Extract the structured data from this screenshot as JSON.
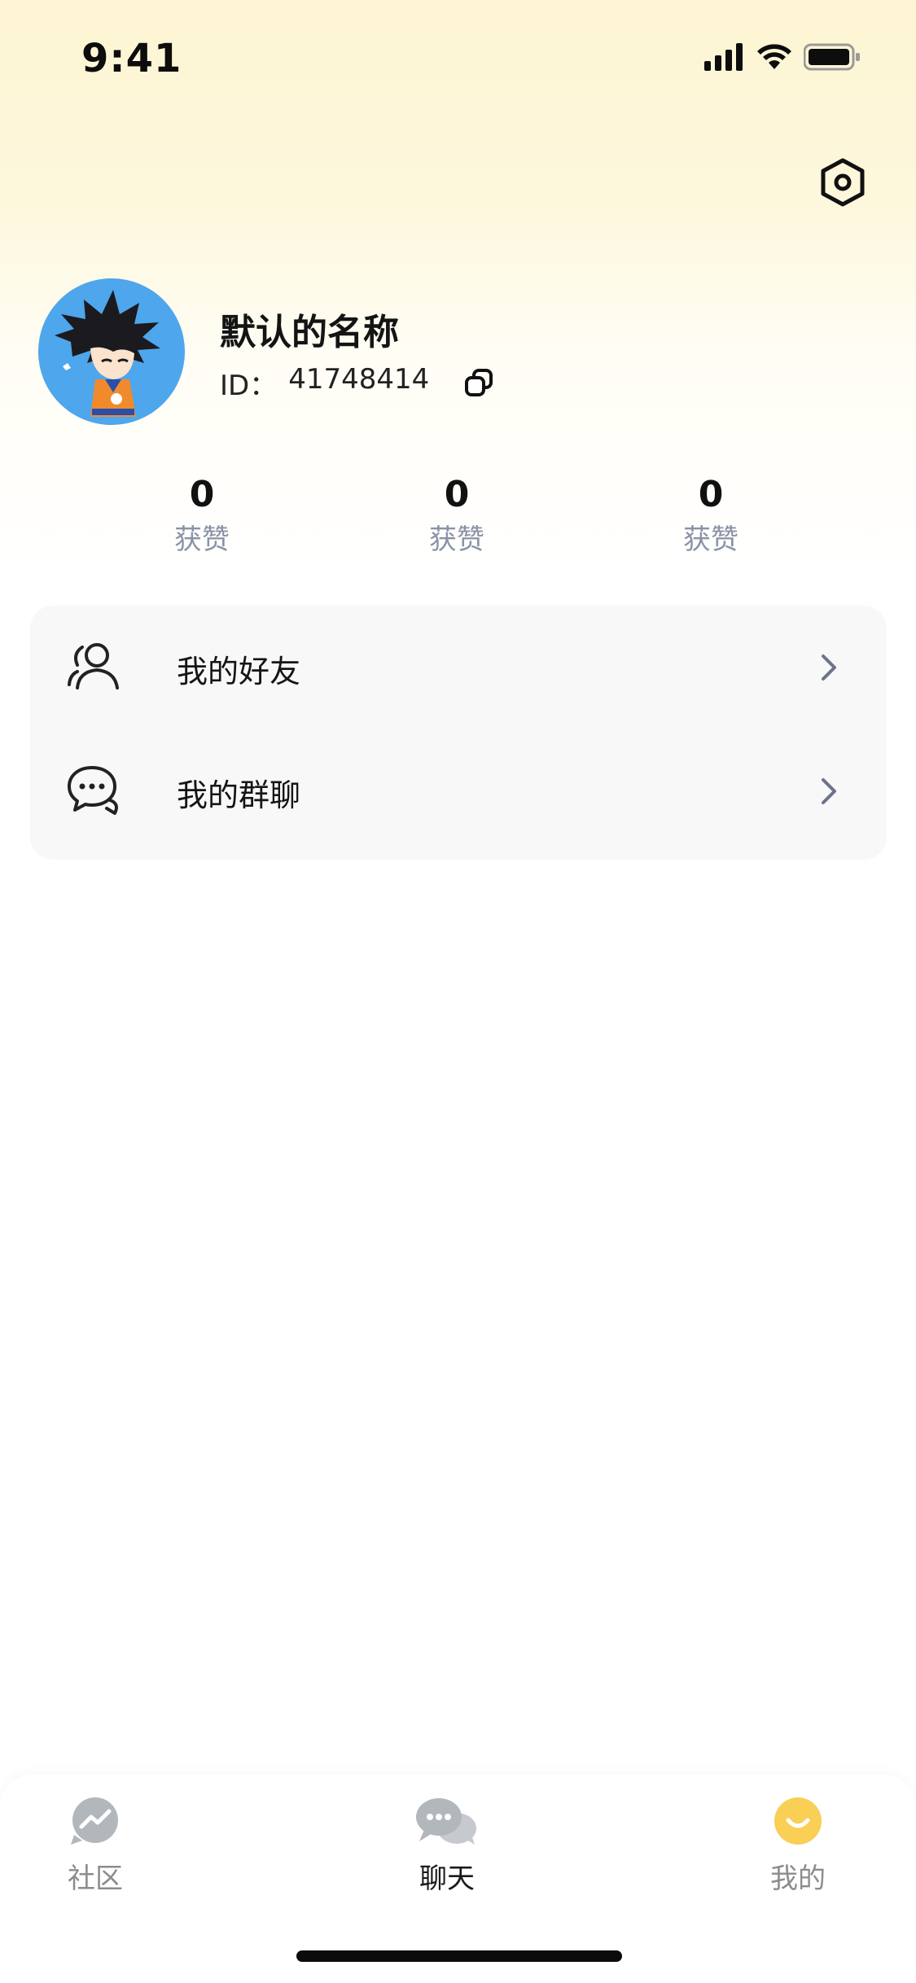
{
  "status_bar": {
    "time": "9:41",
    "icons": [
      "signal-icon",
      "wifi-icon",
      "battery-icon"
    ]
  },
  "header": {
    "settings_icon": "settings-hexagon-icon"
  },
  "profile": {
    "name": "默认的名称",
    "id_label": "ID：",
    "id_value": "41748414",
    "avatar_icon": "cartoon-avatar",
    "copy_icon": "copy-icon"
  },
  "stats": [
    {
      "value": "0",
      "label": "获赞"
    },
    {
      "value": "0",
      "label": "获赞"
    },
    {
      "value": "0",
      "label": "获赞"
    }
  ],
  "menu": [
    {
      "label": "我的好友",
      "icon": "friends-icon"
    },
    {
      "label": "我的群聊",
      "icon": "group-chat-icon"
    }
  ],
  "tab_bar": {
    "tabs": [
      {
        "label": "社区",
        "icon": "community-icon",
        "active": false
      },
      {
        "label": "聊天",
        "icon": "chat-icon",
        "active": true
      },
      {
        "label": "我的",
        "icon": "profile-smile-icon",
        "active": false
      }
    ]
  },
  "colors": {
    "accent_yellow": "#f9cf55",
    "inactive_gray": "#b2b7bc",
    "subtle_text": "#8a93a6",
    "avatar_bg": "#4ea6ec",
    "card_bg": "#f8f8f9"
  }
}
